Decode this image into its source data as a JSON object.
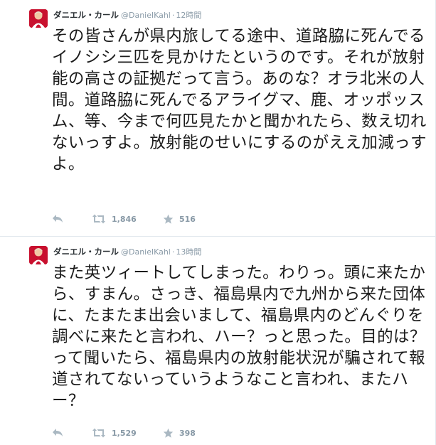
{
  "colors": {
    "icon_gray": "#aab8c2",
    "meta_gray": "#8899a6",
    "divider": "#e1e8ed",
    "avatar_red": "#c8102e"
  },
  "tweets": [
    {
      "fullname": "ダニエル・カール",
      "username": "@DanielKahl",
      "separator": "·",
      "time": "12時間",
      "text": "その皆さんが県内旅してる途中、道路脇に死んでるイノシシ三匹を見かけたというのです。それが放射能の高さの証拠だって言う。あのな？オラ北米の人間。道路脇に死んでるアライグマ、鹿、オッポッスム、等、今まで何匹見たかと聞かれたら、数え切れないっすよ。放射能のせいにするのがええ加減っすよ。",
      "retweets": "1,846",
      "favorites": "516"
    },
    {
      "fullname": "ダニエル・カール",
      "username": "@DanielKahl",
      "separator": "·",
      "time": "13時間",
      "text": "また英ツィートしてしまった。わりっ。頭に来たから、すまん。さっき、福島県内で九州から来た団体に、たまたま出会いまして、福島県内のどんぐりを調べに来たと言われ、ハー？っと思った。目的は？って聞いたら、福島県内の放射能状況が騙されて報道されてないっていうようなこと言われ、またハー？",
      "retweets": "1,529",
      "favorites": "398"
    }
  ]
}
